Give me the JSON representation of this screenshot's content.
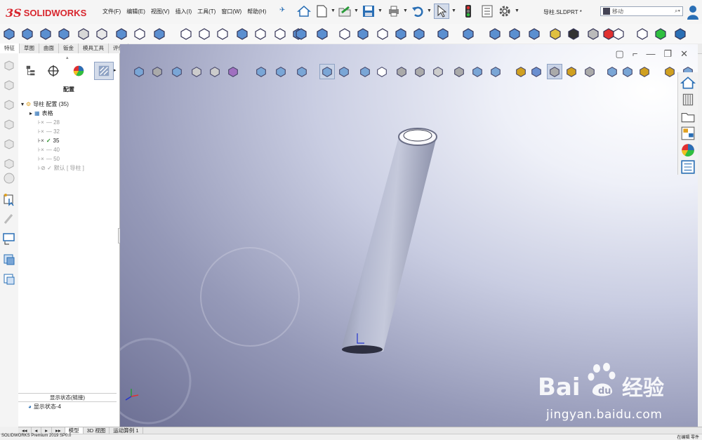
{
  "app": {
    "brand": "SOLIDWORKS",
    "document_title": "导柱.SLDPRT *",
    "search_placeholder": "移动"
  },
  "menubar": [
    "文件(F)",
    "编辑(E)",
    "视图(V)",
    "插入(I)",
    "工具(T)",
    "窗口(W)",
    "帮助(H)"
  ],
  "cmd_tabs": [
    {
      "label": "特征",
      "active": true
    },
    {
      "label": "草图",
      "active": false
    },
    {
      "label": "曲面",
      "active": false
    },
    {
      "label": "钣金",
      "active": false
    },
    {
      "label": "模具工具",
      "active": false
    },
    {
      "label": "评估",
      "active": false
    }
  ],
  "config_panel": {
    "title": "配置",
    "root": "导柱 配置  (35)",
    "table": "表格",
    "configs": [
      {
        "label": "— 28",
        "active": false
      },
      {
        "label": "— 32",
        "active": false
      },
      {
        "label": "35",
        "active": true
      },
      {
        "label": "— 40",
        "active": false
      },
      {
        "label": "— 50",
        "active": false
      },
      {
        "label": "默认 [ 导柱 ]",
        "active": false
      }
    ],
    "display_state_header": "显示状态(链接)",
    "display_state": "显示状态-4"
  },
  "bottom_tabs": [
    {
      "label": "模型",
      "active": true
    },
    {
      "label": "3D 视图",
      "active": false
    },
    {
      "label": "运动算例 1",
      "active": false
    }
  ],
  "status": {
    "left": "SOLIDWORKS Premium 2019 SP0.0",
    "right": "在编辑 零件"
  },
  "watermark": {
    "brand": "Bai du 经验",
    "url": "jingyan.baidu.com"
  },
  "colors": {
    "brand_red": "#d8262e",
    "accent_blue": "#2a6fb5",
    "part_gray": "#a9afc8"
  }
}
